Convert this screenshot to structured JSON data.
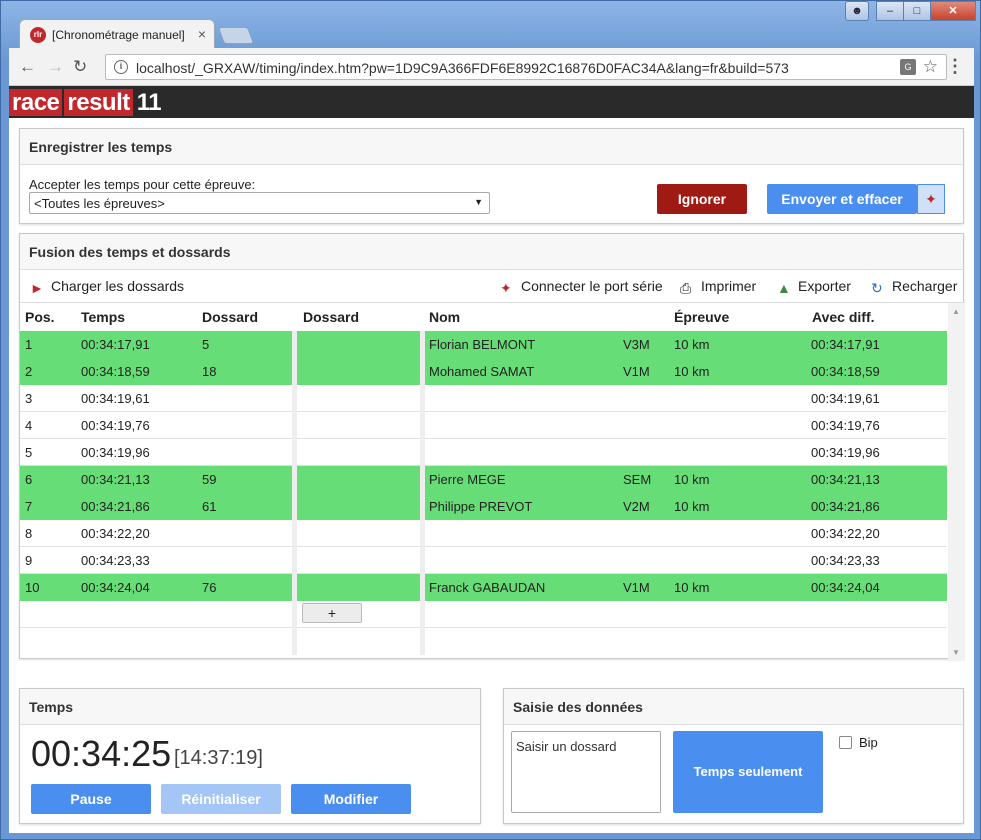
{
  "browser": {
    "tab_title": "[Chronométrage manuel]",
    "favicon_text": "rlr",
    "url": "localhost/_GRXAW/timing/index.htm?pw=1D9C9A366FDF6E8992C16876D0FAC34A&lang=fr&build=573"
  },
  "brand": {
    "part1": "race",
    "part2": "result",
    "part3": "11"
  },
  "register": {
    "title": "Enregistrer les temps",
    "accept_label": "Accepter les temps pour cette épreuve:",
    "selected_event": "<Toutes les épreuves>",
    "ignore_label": "Ignorer",
    "send_label": "Envoyer et effacer"
  },
  "fusion": {
    "title": "Fusion des temps et dossards",
    "load_bibs": "Charger les dossards",
    "connect_serial": "Connecter le port série",
    "print": "Imprimer",
    "export": "Exporter",
    "reload": "Recharger",
    "headers": {
      "pos": "Pos.",
      "time": "Temps",
      "bib": "Dossard",
      "bib2": "Dossard",
      "name": "Nom",
      "event": "Épreuve",
      "diff": "Avec diff."
    },
    "rows": [
      {
        "pos": "1",
        "time": "00:34:17,91",
        "bib": "5",
        "name": "Florian BELMONT",
        "cat": "V3M",
        "event": "10 km",
        "diff": "00:34:17,91",
        "matched": true
      },
      {
        "pos": "2",
        "time": "00:34:18,59",
        "bib": "18",
        "name": "Mohamed SAMAT",
        "cat": "V1M",
        "event": "10 km",
        "diff": "00:34:18,59",
        "matched": true
      },
      {
        "pos": "3",
        "time": "00:34:19,61",
        "bib": "",
        "name": "",
        "cat": "",
        "event": "",
        "diff": "00:34:19,61",
        "matched": false
      },
      {
        "pos": "4",
        "time": "00:34:19,76",
        "bib": "",
        "name": "",
        "cat": "",
        "event": "",
        "diff": "00:34:19,76",
        "matched": false
      },
      {
        "pos": "5",
        "time": "00:34:19,96",
        "bib": "",
        "name": "",
        "cat": "",
        "event": "",
        "diff": "00:34:19,96",
        "matched": false
      },
      {
        "pos": "6",
        "time": "00:34:21,13",
        "bib": "59",
        "name": "Pierre MEGE",
        "cat": "SEM",
        "event": "10 km",
        "diff": "00:34:21,13",
        "matched": true
      },
      {
        "pos": "7",
        "time": "00:34:21,86",
        "bib": "61",
        "name": "Philippe PREVOT",
        "cat": "V2M",
        "event": "10 km",
        "diff": "00:34:21,86",
        "matched": true
      },
      {
        "pos": "8",
        "time": "00:34:22,20",
        "bib": "",
        "name": "",
        "cat": "",
        "event": "",
        "diff": "00:34:22,20",
        "matched": false
      },
      {
        "pos": "9",
        "time": "00:34:23,33",
        "bib": "",
        "name": "",
        "cat": "",
        "event": "",
        "diff": "00:34:23,33",
        "matched": false
      },
      {
        "pos": "10",
        "time": "00:34:24,04",
        "bib": "76",
        "name": "Franck GABAUDAN",
        "cat": "V1M",
        "event": "10 km",
        "diff": "00:34:24,04",
        "matched": true
      }
    ],
    "add_label": "+"
  },
  "timer": {
    "title": "Temps",
    "elapsed": "00:34:25",
    "clock": "[14:37:19]",
    "pause": "Pause",
    "reset": "Réinitialiser",
    "modify": "Modifier"
  },
  "entry": {
    "title": "Saisie des données",
    "placeholder": "Saisir un dossard",
    "time_only": "Temps seulement",
    "beep": "Bip"
  },
  "colors": {
    "matched_row": "#66dd77",
    "primary": "#4a8ff0",
    "danger": "#a01a14",
    "brand": "#c0282d"
  }
}
